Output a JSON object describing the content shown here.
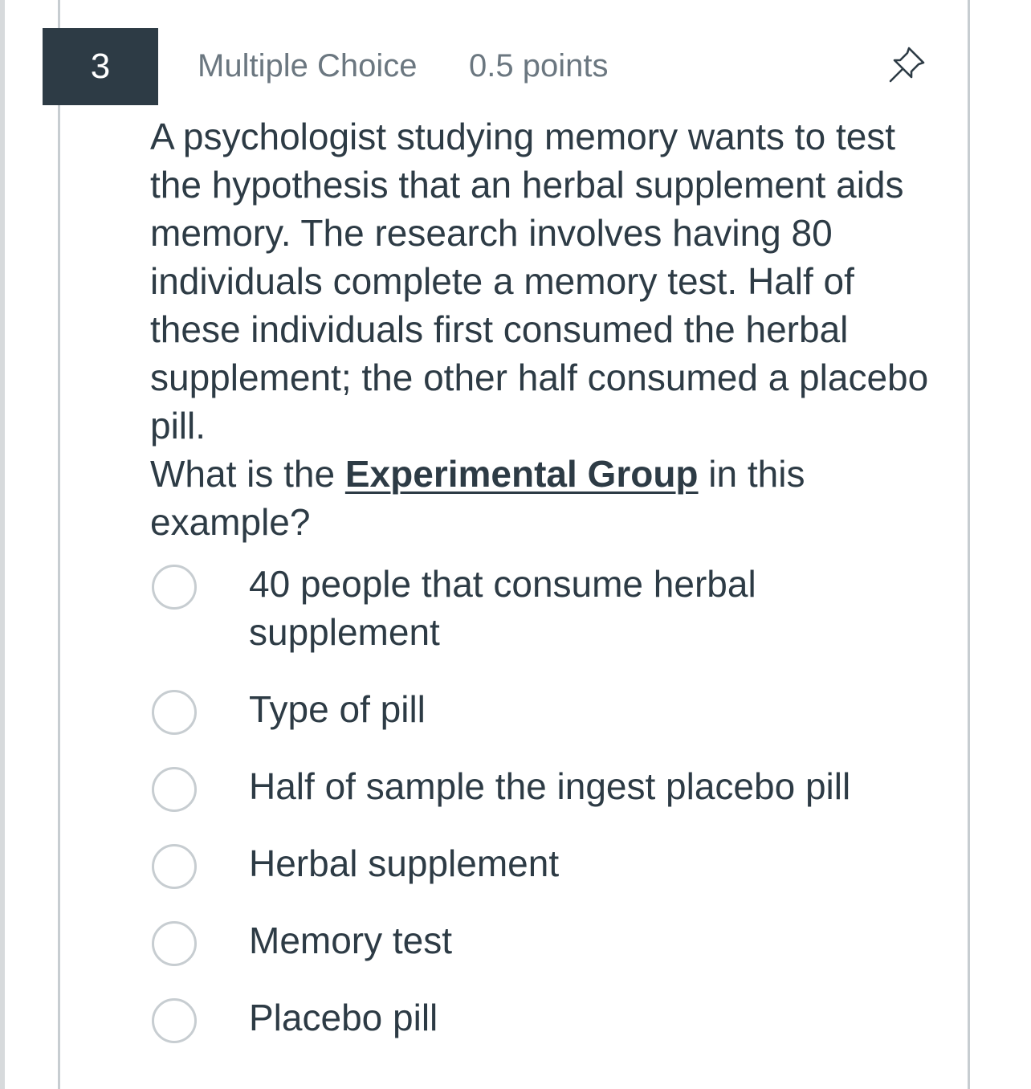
{
  "question": {
    "number": "3",
    "type": "Multiple Choice",
    "points": "0.5 points",
    "body": "A psychologist studying memory wants to test the hypothesis that an herbal supplement aids memory. The research involves having 80 individuals complete a memory test. Half of these individuals first consumed the herbal supplement; the other half consumed a placebo pill.",
    "prompt_before": "What is the ",
    "prompt_emphasis": "Experimental Group",
    "prompt_after": " in this example?"
  },
  "options": [
    {
      "label": "40 people that consume herbal supplement",
      "selected": false
    },
    {
      "label": "Type of pill",
      "selected": false
    },
    {
      "label": "Half of sample the ingest placebo pill",
      "selected": false
    },
    {
      "label": "Herbal supplement",
      "selected": false
    },
    {
      "label": "Memory test",
      "selected": false
    },
    {
      "label": "Placebo pill",
      "selected": false
    }
  ],
  "icons": {
    "pin": "pushpin-icon"
  },
  "colors": {
    "header_badge_bg": "#2d3b45",
    "text": "#2d3b45",
    "muted_text": "#6b7780",
    "radio_border": "#c7cdd1"
  }
}
